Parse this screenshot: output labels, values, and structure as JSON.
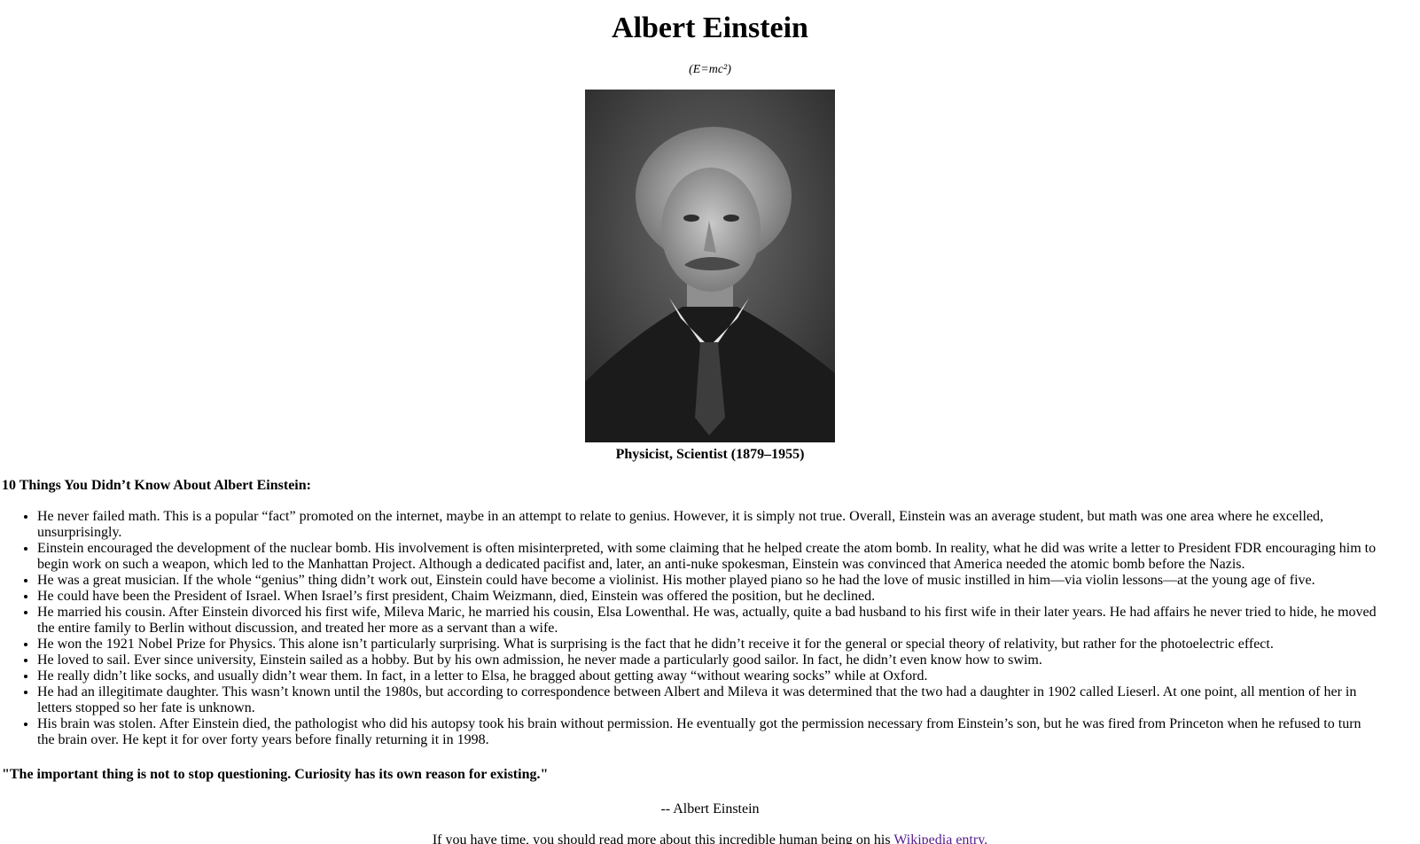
{
  "header": {
    "title": "Albert Einstein",
    "subtitle": "(E=mc²)"
  },
  "figure": {
    "image_description_icon": "portrait-photo",
    "caption": "Physicist, Scientist (1879–1955)"
  },
  "facts": {
    "heading": "10 Things You Didn’t Know About Albert Einstein:",
    "items": [
      "He never failed math. This is a popular “fact” promoted on the internet, maybe in an attempt to relate to genius. However, it is simply not true. Overall, Einstein was an average student, but math was one area where he excelled, unsurprisingly.",
      "Einstein encouraged the development of the nuclear bomb. His involvement is often misinterpreted, with some claiming that he helped create the atom bomb. In reality, what he did was write a letter to President FDR encouraging him to begin work on such a weapon, which led to the Manhattan Project. Although a dedicated pacifist and, later, an anti-nuke spokesman, Einstein was convinced that America needed the atomic bomb before the Nazis.",
      "He was a great musician. If the whole “genius” thing didn’t work out, Einstein could have become a violinist. His mother played piano so he had the love of music instilled in him—via violin lessons—at the young age of five.",
      "He could have been the President of Israel. When Israel’s first president, Chaim Weizmann, died, Einstein was offered the position, but he declined.",
      "He married his cousin. After Einstein divorced his first wife, Mileva Maric, he married his cousin, Elsa Lowenthal. He was, actually, quite a bad husband to his first wife in their later years. He had affairs he never tried to hide, he moved the entire family to Berlin without discussion, and treated her more as a servant than a wife.",
      "He won the 1921 Nobel Prize for Physics. This alone isn’t particularly surprising. What is surprising is the fact that he didn’t receive it for the general or special theory of relativity, but rather for the photoelectric effect.",
      "He loved to sail. Ever since university, Einstein sailed as a hobby. But by his own admission, he never made a particularly good sailor. In fact, he didn’t even know how to swim.",
      "He really didn’t like socks, and usually didn’t wear them. In fact, in a letter to Elsa, he bragged about getting away “without wearing socks” while at Oxford.",
      "He had an illegitimate daughter. This wasn’t known until the 1980s, but according to correspondence between Albert and Mileva it was determined that the two had a daughter in 1902 called Lieserl. At one point, all mention of her in letters stopped so her fate is unknown.",
      "His brain was stolen. After Einstein died, the pathologist who did his autopsy took his brain without permission. He eventually got the permission necessary from Einstein’s son, but he was fired from Princeton when he refused to turn the brain over. He kept it for over forty years before finally returning it in 1998."
    ]
  },
  "quote": {
    "text": "\"The important thing is not to stop questioning. Curiosity has its own reason for existing.\"",
    "attribution": "-- Albert Einstein"
  },
  "footer": {
    "text": "If you have time, you should read more about this incredible human being on his ",
    "link_label": "Wikipedia entry."
  }
}
